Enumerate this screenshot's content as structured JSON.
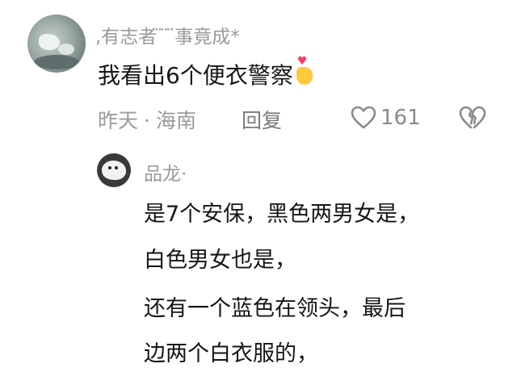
{
  "comment": {
    "username": ",有志者 ̈ ̈ ̈事竟成*",
    "text": "我看出6个便衣警察",
    "emoji_icon": "finger-heart-icon",
    "date": "昨天",
    "separator": "·",
    "location": "海南",
    "reply_label": "回复",
    "like_count": "161",
    "like_icon": "heart-outline-icon",
    "dislike_icon": "broken-heart-outline-icon"
  },
  "reply": {
    "username": "品龙·",
    "lines": [
      "是7个安保，黑色两男女是，",
      "白色男女也是，",
      "还有一个蓝色在领头，最后",
      "边两个白衣服的，"
    ]
  },
  "colors": {
    "text_primary": "#151515",
    "text_secondary": "#9a9a9a",
    "background": "#ffffff",
    "emoji_heart": "#ff3b6b",
    "emoji_hand": "#ffc83d"
  }
}
